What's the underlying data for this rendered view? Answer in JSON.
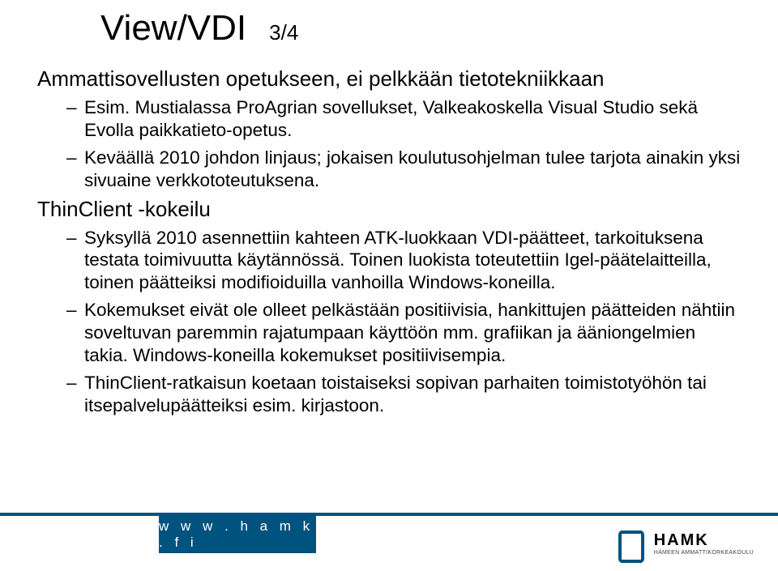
{
  "title": "View/VDI",
  "title_sub": "3/4",
  "sections": [
    {
      "heading": "Ammattisovellusten opetukseen, ei pelkkään tietotekniikkaan",
      "bullets": [
        "Esim. Mustialassa ProAgrian sovellukset, Valkeakoskella Visual Studio sekä Evolla paikkatieto-opetus.",
        "Keväällä 2010 johdon linjaus; jokaisen koulutusohjelman tulee tarjota ainakin yksi sivuaine verkkototeutuksena."
      ]
    },
    {
      "heading": "ThinClient -kokeilu",
      "bullets": [
        "Syksyllä 2010 asennettiin kahteen ATK-luokkaan VDI-päätteet, tarkoituksena testata toimivuutta käytännössä. Toinen luokista toteutettiin Igel-päätelaitteilla, toinen päätteiksi modifioiduilla vanhoilla Windows-koneilla.",
        "Kokemukset eivät ole olleet pelkästään positiivisia, hankittujen päätteiden nähtiin soveltuvan paremmin rajatumpaan käyttöön mm. grafiikan ja ääniongelmien takia. Windows-koneilla kokemukset positiivisempia.",
        "ThinClient-ratkaisun koetaan toistaiseksi sopivan parhaiten toimistotyöhön tai itsepalvelupäätteiksi esim. kirjastoon."
      ]
    }
  ],
  "footer": {
    "url": "w w w . h a m k . f i",
    "logo_name": "HAMK",
    "logo_sub": "HÄMEEN AMMATTIKORKEAKOULU"
  }
}
